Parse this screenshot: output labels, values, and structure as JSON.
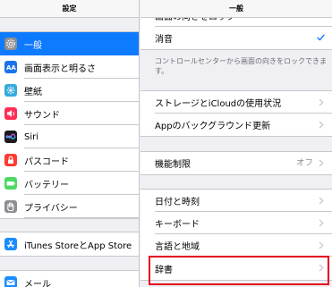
{
  "sidebar": {
    "title": "設定",
    "group1": [
      {
        "label": "一般",
        "icon": "gear-icon",
        "color": "#8e8e93",
        "selected": true
      },
      {
        "label": "画面表示と明るさ",
        "icon": "brightness-icon",
        "color": "#1a73e8"
      },
      {
        "label": "壁紙",
        "icon": "wallpaper-icon",
        "color": "#34aadc"
      },
      {
        "label": "サウンド",
        "icon": "sound-icon",
        "color": "#ff2d55"
      },
      {
        "label": "Siri",
        "icon": "siri-icon",
        "color": "#1c1c1e"
      },
      {
        "label": "パスコード",
        "icon": "lock-icon",
        "color": "#ff3b30"
      },
      {
        "label": "バッテリー",
        "icon": "battery-icon",
        "color": "#4cd964"
      },
      {
        "label": "プライバシー",
        "icon": "hand-icon",
        "color": "#8e8e93"
      }
    ],
    "group2": [
      {
        "label": "iTunes StoreとApp Store",
        "icon": "app-store-icon",
        "color": "#1a8cff"
      }
    ],
    "group3": [
      {
        "label": "メール",
        "icon": "mail-icon",
        "color": "#1a8cff"
      }
    ]
  },
  "detail": {
    "title": "一般",
    "orientation_group": [
      {
        "label": "画面の向きをロック",
        "accessory": "none"
      },
      {
        "label": "消音",
        "accessory": "checkmark"
      }
    ],
    "orientation_note": "コントロールセンターから画面の向きをロックできます。",
    "storage_group": [
      {
        "label": "ストレージとiCloudの使用状況",
        "accessory": "chevron"
      },
      {
        "label": "Appのバックグラウンド更新",
        "accessory": "chevron"
      }
    ],
    "restrictions_group": [
      {
        "label": "機能制限",
        "value": "オフ",
        "accessory": "chevron"
      }
    ],
    "locale_group": [
      {
        "label": "日付と時刻",
        "accessory": "chevron"
      },
      {
        "label": "キーボード",
        "accessory": "chevron"
      },
      {
        "label": "言語と地域",
        "accessory": "chevron"
      },
      {
        "label": "辞書",
        "accessory": "chevron"
      }
    ]
  },
  "colors": {
    "accent": "#0e7afe",
    "highlight": "#e4001c",
    "chevron": "#c7c7cc"
  }
}
